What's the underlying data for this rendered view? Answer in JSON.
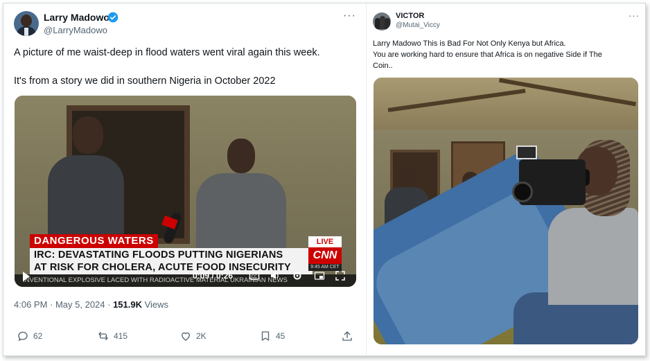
{
  "left_tweet": {
    "author_name": "Larry Madowo",
    "handle": "@LarryMadowo",
    "more": "···",
    "text_line1": "A picture of me waist-deep in flood waters went viral again this week.",
    "text_line2": "It's from a story we did in southern Nigeria in October 2022",
    "video": {
      "tag": "DANGEROUS WATERS",
      "headline_line1": "IRC: DEVASTATING FLOODS PUTTING NIGERIANS",
      "headline_line2": "AT RISK FOR CHOLERA, ACUTE FOOD INSECURITY",
      "live": "LIVE",
      "network": "CNN",
      "clock": "9:45 AM CET",
      "ticker": "INVENTIONAL EXPLOSIVE LACED WITH RADIOACTIVE MATERIAL      UKRAINIAN NEWS",
      "time": "0:09 / 0:26",
      "progress_fraction": 0.35
    },
    "timestamp": "4:06 PM · May 5, 2024 · ",
    "views_count": "151.9K",
    "views_label": " Views",
    "actions": {
      "replies": "62",
      "reposts": "415",
      "likes": "2K",
      "bookmarks": "45"
    }
  },
  "right_tweet": {
    "author_name": "VICTOR",
    "handle": "@Mutai_Viccy",
    "more": "···",
    "text_line1": "Larry Madowo This is Bad For Not Only Kenya but Africa.",
    "text_line2": "You are working hard to ensure that Africa is on negative Side if The",
    "text_line3": "Coin.."
  },
  "colors": {
    "verified_blue": "#1d9bf0",
    "cnn_red": "#cc0000",
    "secondary_text": "#536471"
  }
}
